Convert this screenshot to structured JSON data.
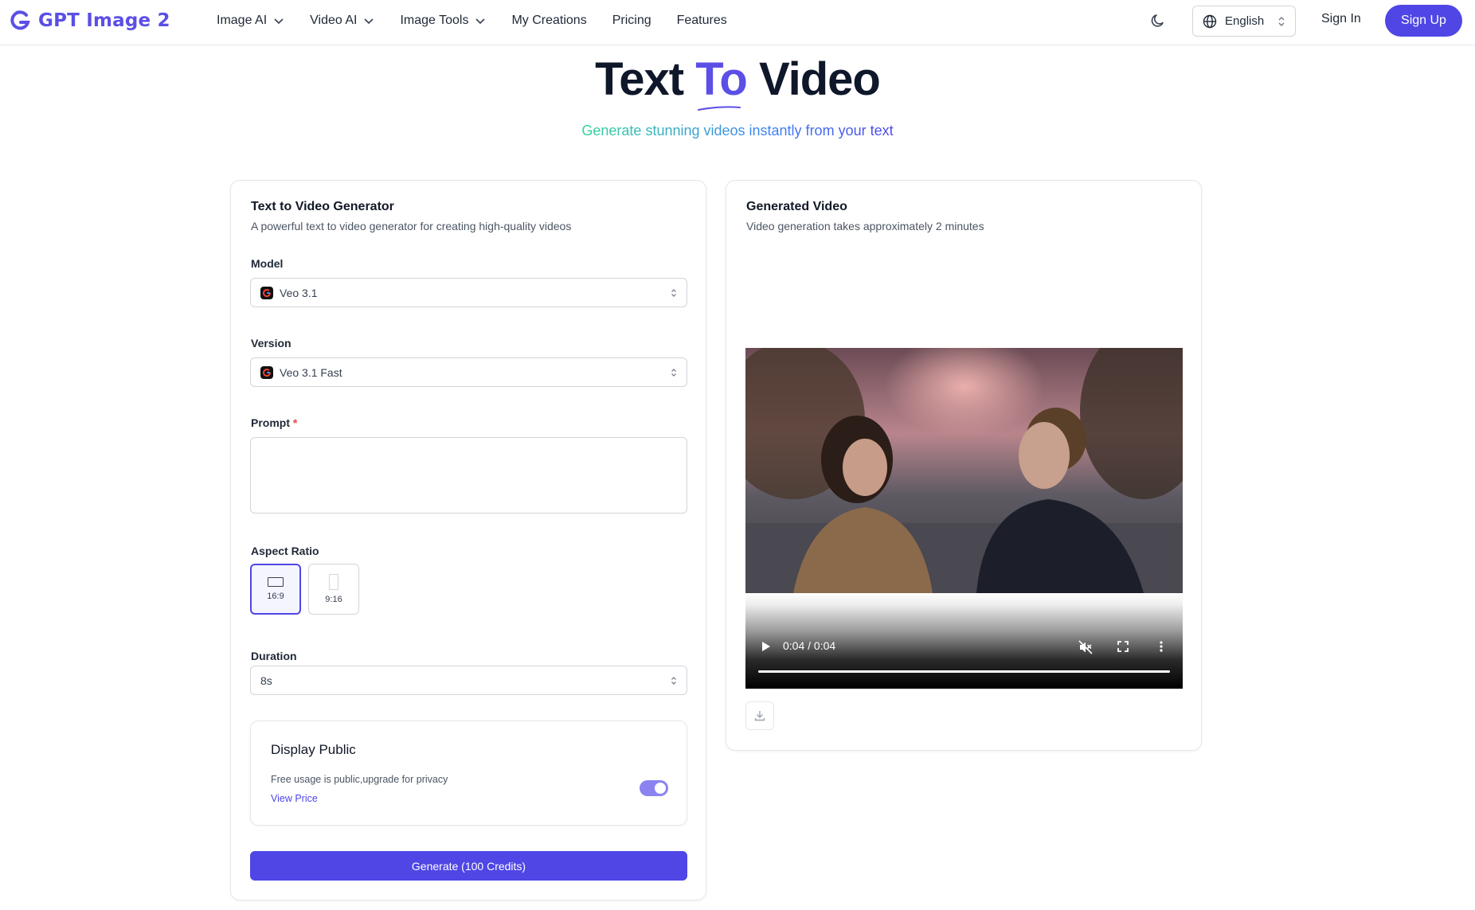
{
  "header": {
    "logo_text": "GPT Image 2",
    "nav": [
      {
        "label": "Image AI",
        "dropdown": true
      },
      {
        "label": "Video AI",
        "dropdown": true
      },
      {
        "label": "Image Tools",
        "dropdown": true
      },
      {
        "label": "My Creations",
        "dropdown": false
      },
      {
        "label": "Pricing",
        "dropdown": false
      },
      {
        "label": "Features",
        "dropdown": false
      }
    ],
    "language": "English",
    "sign_in": "Sign In",
    "sign_up": "Sign Up"
  },
  "hero": {
    "title_part1": "Text",
    "title_accent": "To",
    "title_part2": "Video",
    "subtitle": "Generate stunning videos instantly from your text"
  },
  "generator": {
    "title": "Text to Video Generator",
    "description": "A powerful text to video generator for creating high-quality videos",
    "model_label": "Model",
    "model_value": "Veo 3.1",
    "version_label": "Version",
    "version_value": "Veo 3.1 Fast",
    "prompt_label": "Prompt",
    "prompt_required": "*",
    "prompt_value": "",
    "aspect_label": "Aspect Ratio",
    "aspect_options": [
      {
        "label": "16:9",
        "selected": true
      },
      {
        "label": "9:16",
        "selected": false
      }
    ],
    "duration_label": "Duration",
    "duration_value": "8s",
    "public": {
      "title": "Display Public",
      "description": "Free usage is public,upgrade for privacy",
      "link": "View Price",
      "enabled": true
    },
    "generate_label": "Generate (100 Credits)"
  },
  "output": {
    "title": "Generated Video",
    "description": "Video generation takes approximately 2 minutes",
    "time_current": "0:04",
    "time_total": "0:04",
    "progress": 1.0
  },
  "colors": {
    "accent": "#4f46e5",
    "logo": "#5b4fe6"
  },
  "icons": [
    "logo-mark-icon",
    "chevron-down-icon",
    "moon-icon",
    "globe-icon",
    "chevron-updown-icon",
    "play-icon",
    "volume-muted-icon",
    "fullscreen-icon",
    "more-vertical-icon",
    "download-icon"
  ]
}
